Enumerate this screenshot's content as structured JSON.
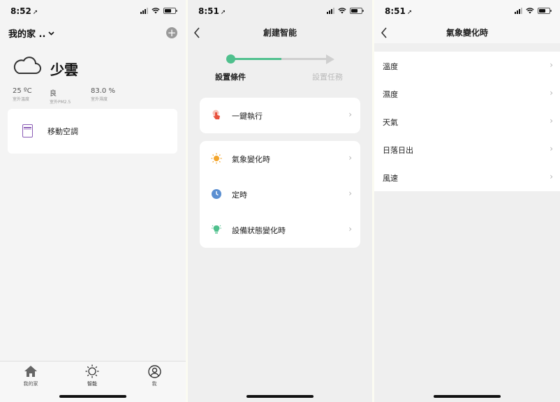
{
  "screens": {
    "home": {
      "time": "8:52",
      "home_title": "我的家 ..",
      "weather": {
        "label": "少雲",
        "icon": "cloud-icon"
      },
      "stats": [
        {
          "value": "25 ºC",
          "label": "室外溫度"
        },
        {
          "value": "良",
          "label": "室外PM2.5"
        },
        {
          "value": "83.0 %",
          "label": "室外濕度"
        }
      ],
      "device": {
        "name": "移動空調",
        "icon": "air-conditioner-icon"
      },
      "tabs": [
        {
          "label": "我的家",
          "icon": "house-icon"
        },
        {
          "label": "智能",
          "icon": "sun-icon"
        },
        {
          "label": "我",
          "icon": "profile-icon"
        }
      ]
    },
    "create": {
      "time": "8:51",
      "title": "創建智能",
      "steps": [
        "設置條件",
        "設置任務"
      ],
      "card1": [
        {
          "label": "一鍵執行",
          "icon": "tap-hand-icon"
        }
      ],
      "card2": [
        {
          "label": "氣象變化時",
          "icon": "sun-icon"
        },
        {
          "label": "定時",
          "icon": "clock-icon"
        },
        {
          "label": "設備狀態變化時",
          "icon": "bulb-icon"
        }
      ],
      "colors": {
        "accent": "#4fc08d",
        "sun": "#f3a52c",
        "clock": "#5b8fd1"
      }
    },
    "weather": {
      "time": "8:51",
      "title": "氣象變化時",
      "items": [
        "溫度",
        "濕度",
        "天氣",
        "日落日出",
        "風速"
      ]
    }
  }
}
